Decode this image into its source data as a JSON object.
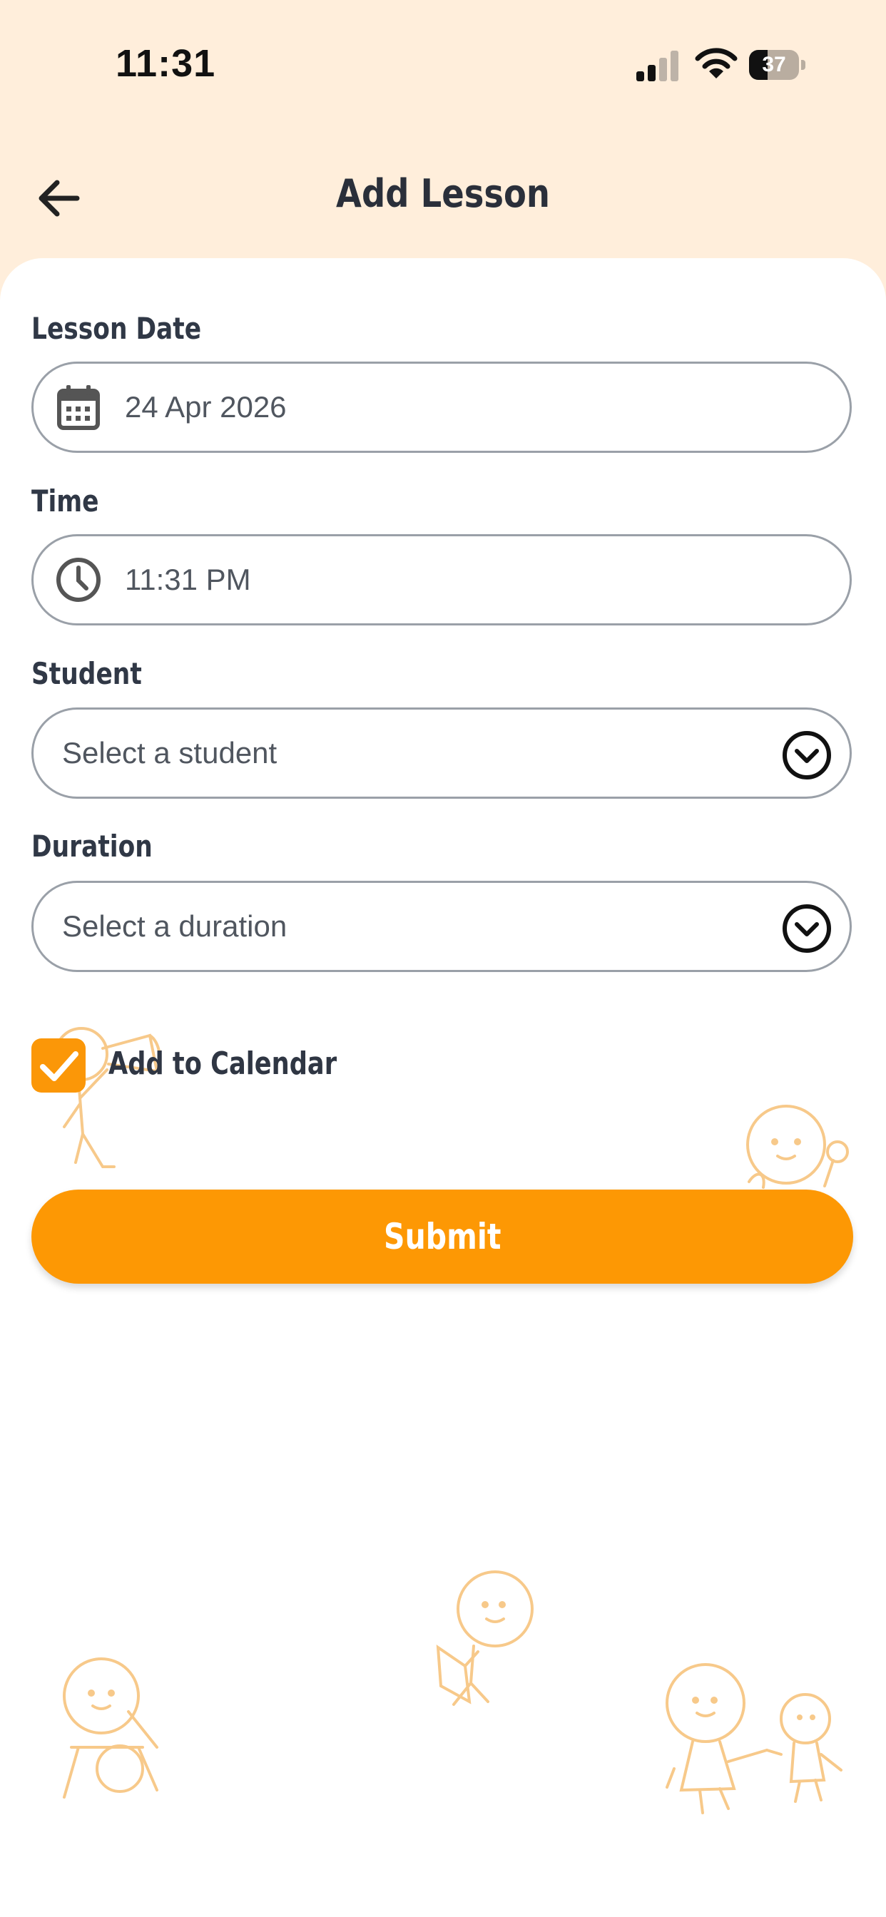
{
  "status_bar": {
    "time": "11:31",
    "battery_level": "37",
    "icons": [
      "signal-icon",
      "wifi-icon",
      "battery-icon"
    ]
  },
  "header": {
    "title": "Add Lesson",
    "back_icon": "arrow-left-icon"
  },
  "form": {
    "lesson_date": {
      "label": "Lesson Date",
      "value": "24 Apr 2026",
      "icon": "calendar-icon"
    },
    "time": {
      "label": "Time",
      "value": "11:31 PM",
      "icon": "clock-icon"
    },
    "student": {
      "label": "Student",
      "placeholder": "Select a student",
      "icon": "chevron-down-circle-icon"
    },
    "duration": {
      "label": "Duration",
      "placeholder": "Select a duration",
      "icon": "chevron-down-circle-icon"
    },
    "add_to_calendar": {
      "label": "Add to Calendar",
      "checked": true
    }
  },
  "submit_label": "Submit",
  "colors": {
    "header_bg": "#ffeedb",
    "accent": "#fd9804",
    "border": "#9aa0a8",
    "doodle": "#f7c98a"
  }
}
